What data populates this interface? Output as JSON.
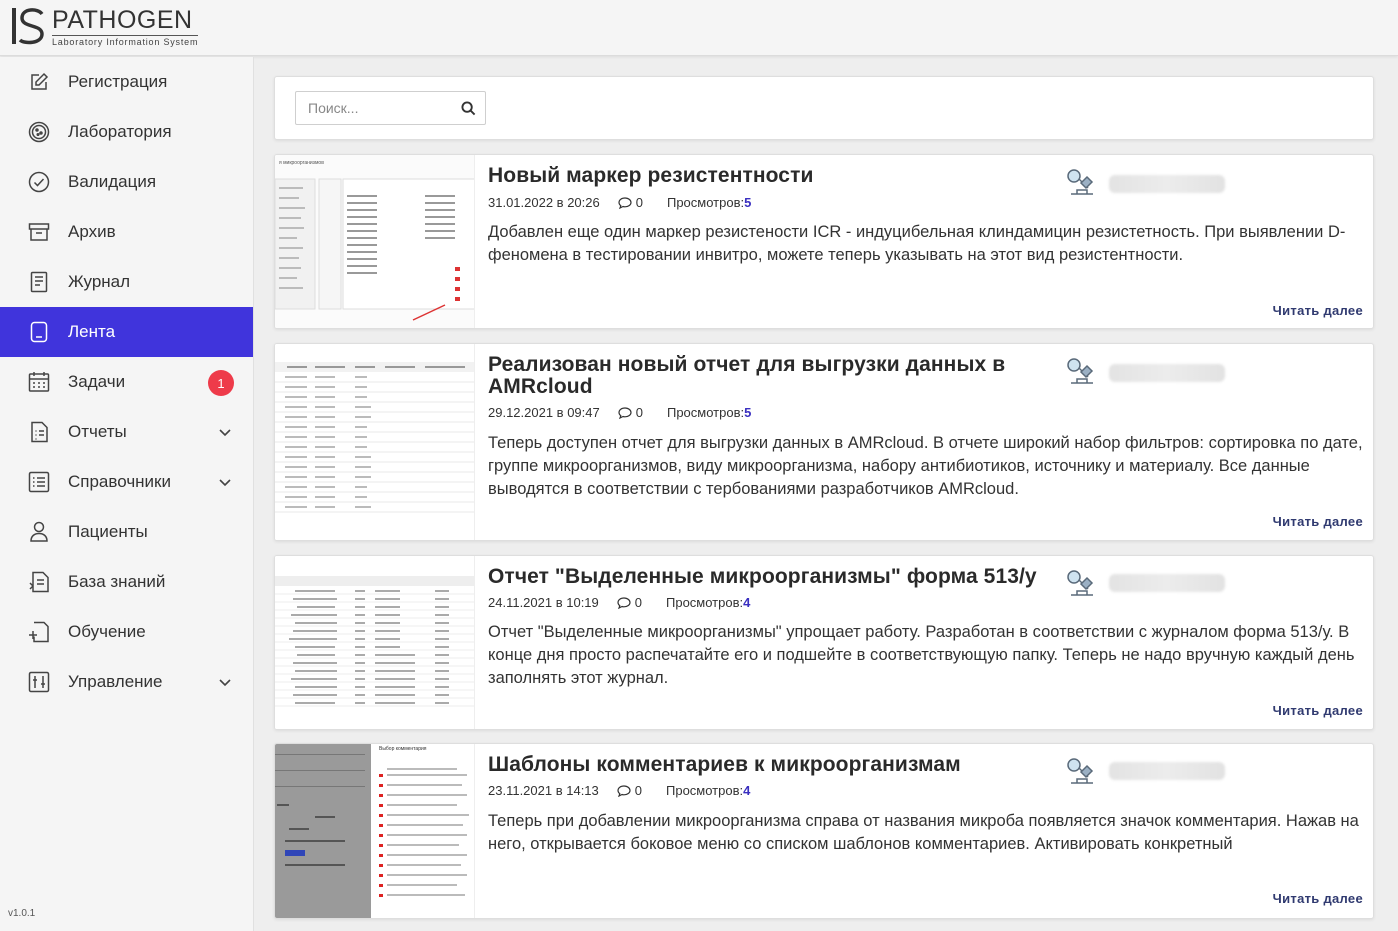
{
  "app": {
    "name": "PATHOGEN",
    "subtitle": "Laboratory Information System",
    "version": "v1.0.1"
  },
  "sidebar": {
    "items": [
      {
        "label": "Регистрация",
        "icon": "edit-icon"
      },
      {
        "label": "Лаборатория",
        "icon": "petri-dish-icon"
      },
      {
        "label": "Валидация",
        "icon": "check-circle-icon"
      },
      {
        "label": "Архив",
        "icon": "archive-icon"
      },
      {
        "label": "Журнал",
        "icon": "journal-icon"
      },
      {
        "label": "Лента",
        "icon": "feed-icon",
        "active": true
      },
      {
        "label": "Задачи",
        "icon": "calendar-icon",
        "badge": "1"
      },
      {
        "label": "Отчеты",
        "icon": "report-icon",
        "expandable": true
      },
      {
        "label": "Справочники",
        "icon": "list-icon",
        "expandable": true
      },
      {
        "label": "Пациенты",
        "icon": "user-icon"
      },
      {
        "label": "База знаний",
        "icon": "knowledge-base-icon"
      },
      {
        "label": "Обучение",
        "icon": "learning-icon"
      },
      {
        "label": "Управление",
        "icon": "sliders-icon",
        "expandable": true
      }
    ]
  },
  "search": {
    "placeholder": "Поиск..."
  },
  "posts": [
    {
      "title": "Новый маркер резистентности",
      "date": "31.01.2022 в 20:26",
      "comments": "0",
      "views_label": "Просмотров:",
      "views": "5",
      "text": "Добавлен еще один маркер резистености ICR - индуцибельная клиндамицин резистетность. При выявлении D-феномена в тестировании инвитро, можете теперь указывать на этот вид резистентности.",
      "read_more": "Читать далее"
    },
    {
      "title": "Реализован новый отчет для выгрузки данных в AMRcloud",
      "date": "29.12.2021 в 09:47",
      "comments": "0",
      "views_label": "Просмотров:",
      "views": "5",
      "text": "Теперь доступен отчет для выгрузки данных в AMRcloud. В отчете широкий набор фильтров: сортировка по дате, группе микроорганизмов, виду микроорганизма, набору антибиотиков, источнику и материалу. Все данные выводятся в соответствии с тербованиями разработчиков AMRcloud.",
      "read_more": "Читать далее"
    },
    {
      "title": "Отчет \"Выделенные микроорганизмы\" форма 513/у",
      "date": "24.11.2021 в 10:19",
      "comments": "0",
      "views_label": "Просмотров:",
      "views": "4",
      "text": "Отчет \"Выделенные микроорганизмы\" упрощает работу. Разработан в соответствии с журналом форма 513/у. В конце дня просто распечатайте его и подшейте в соответствующую папку. Теперь не надо вручную каждый день заполнять этот журнал.",
      "read_more": "Читать далее"
    },
    {
      "title": "Шаблоны комментариев к микроорганизмам",
      "date": "23.11.2021 в 14:13",
      "comments": "0",
      "views_label": "Просмотров:",
      "views": "4",
      "text": "Теперь при добавлении микроорганизма справа от названия микроба появляется значок комментария. Нажав на него, открывается боковое меню со списком шаблонов комментариев. Активировать конкретный",
      "read_more": "Читать далее"
    }
  ],
  "colors": {
    "accent": "#4034dc",
    "badge": "#ee3b4a",
    "views": "#3a2fc0",
    "read_more": "#303a70"
  }
}
